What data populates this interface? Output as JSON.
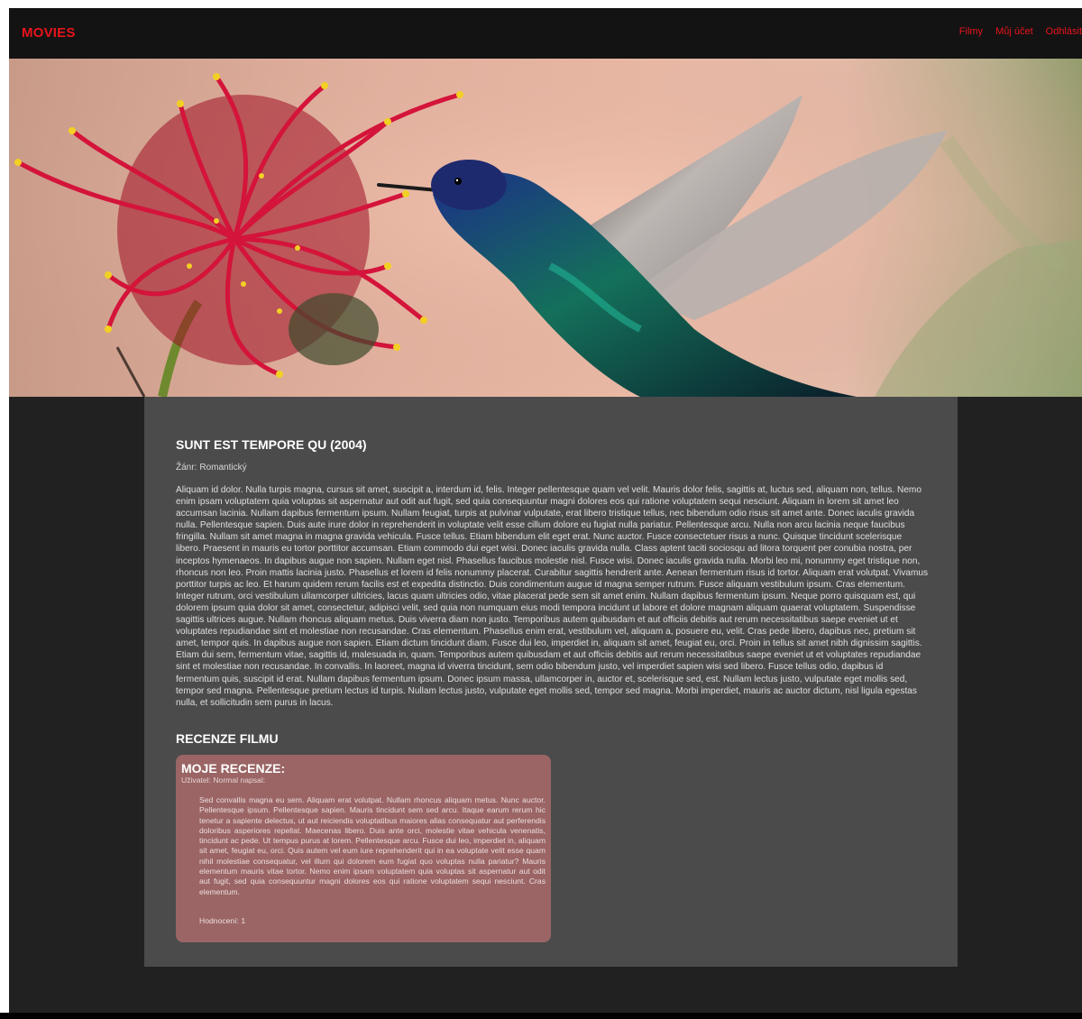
{
  "header": {
    "brand": "MOVIES",
    "nav": [
      "Filmy",
      "Můj účet",
      "Odhlásit"
    ]
  },
  "hero": {
    "alt": "Kolibřík u květu grevilley",
    "colors": {
      "flower": "#c8102e",
      "stamen_tip": "#f2d024",
      "bird_head": "#1e3a8a",
      "bird_body": "#0f5c4a",
      "wing": "#c9c3c0"
    }
  },
  "movie": {
    "title": "SUNT EST TEMPORE QU (2004)",
    "genre_label": "Žánr:",
    "genre": "Romantický",
    "description": "Aliquam id dolor. Nulla turpis magna, cursus sit amet, suscipit a, interdum id, felis. Integer pellentesque quam vel velit. Mauris dolor felis, sagittis at, luctus sed, aliquam non, tellus. Nemo enim ipsam voluptatem quia voluptas sit aspernatur aut odit aut fugit, sed quia consequuntur magni dolores eos qui ratione voluptatem sequi nesciunt. Aliquam in lorem sit amet leo accumsan lacinia. Nullam dapibus fermentum ipsum. Nullam feugiat, turpis at pulvinar vulputate, erat libero tristique tellus, nec bibendum odio risus sit amet ante. Donec iaculis gravida nulla. Pellentesque sapien. Duis aute irure dolor in reprehenderit in voluptate velit esse cillum dolore eu fugiat nulla pariatur. Pellentesque arcu. Nulla non arcu lacinia neque faucibus fringilla. Nullam sit amet magna in magna gravida vehicula. Fusce tellus. Etiam bibendum elit eget erat. Nunc auctor. Fusce consectetuer risus a nunc. Quisque tincidunt scelerisque libero. Praesent in mauris eu tortor porttitor accumsan. Etiam commodo dui eget wisi. Donec iaculis gravida nulla. Class aptent taciti sociosqu ad litora torquent per conubia nostra, per inceptos hymenaeos. In dapibus augue non sapien. Nullam eget nisl. Phasellus faucibus molestie nisl. Fusce wisi. Donec iaculis gravida nulla. Morbi leo mi, nonummy eget tristique non, rhoncus non leo. Proin mattis lacinia justo. Phasellus et lorem id felis nonummy placerat. Curabitur sagittis hendrerit ante. Aenean fermentum risus id tortor. Aliquam erat volutpat. Vivamus porttitor turpis ac leo. Et harum quidem rerum facilis est et expedita distinctio. Duis condimentum augue id magna semper rutrum. Fusce aliquam vestibulum ipsum. Cras elementum. Integer rutrum, orci vestibulum ullamcorper ultricies, lacus quam ultricies odio, vitae placerat pede sem sit amet enim. Nullam dapibus fermentum ipsum. Neque porro quisquam est, qui dolorem ipsum quia dolor sit amet, consectetur, adipisci velit, sed quia non numquam eius modi tempora incidunt ut labore et dolore magnam aliquam quaerat voluptatem. Suspendisse sagittis ultrices augue. Nullam rhoncus aliquam metus. Duis viverra diam non justo. Temporibus autem quibusdam et aut officiis debitis aut rerum necessitatibus saepe eveniet ut et voluptates repudiandae sint et molestiae non recusandae. Cras elementum. Phasellus enim erat, vestibulum vel, aliquam a, posuere eu, velit. Cras pede libero, dapibus nec, pretium sit amet, tempor quis. In dapibus augue non sapien. Etiam dictum tincidunt diam. Fusce dui leo, imperdiet in, aliquam sit amet, feugiat eu, orci. Proin in tellus sit amet nibh dignissim sagittis. Etiam dui sem, fermentum vitae, sagittis id, malesuada in, quam. Temporibus autem quibusdam et aut officiis debitis aut rerum necessitatibus saepe eveniet ut et voluptates repudiandae sint et molestiae non recusandae. In convallis. In laoreet, magna id viverra tincidunt, sem odio bibendum justo, vel imperdiet sapien wisi sed libero. Fusce tellus odio, dapibus id fermentum quis, suscipit id erat. Nullam dapibus fermentum ipsum. Donec ipsum massa, ullamcorper in, auctor et, scelerisque sed, est. Nullam lectus justo, vulputate eget mollis sed, tempor sed magna. Pellentesque pretium lectus id turpis. Nullam lectus justo, vulputate eget mollis sed, tempor sed magna. Morbi imperdiet, mauris ac auctor dictum, nisl ligula egestas nulla, et sollicitudin sem purus in lacus."
  },
  "reviews": {
    "heading": "RECENZE FILMU",
    "card": {
      "title": "MOJE RECENZE:",
      "author_line": "Uživatel: Normal napsal:",
      "text": "Sed convallis magna eu sem. Aliquam erat volutpat. Nullam rhoncus aliquam metus. Nunc auctor. Pellentesque ipsum. Pellentesque sapien. Mauris tincidunt sem sed arcu. Itaque earum rerum hic tenetur a sapiente delectus, ut aut reiciendis voluptatibus maiores alias consequatur aut perferendis doloribus asperiores repellat. Maecenas libero. Duis ante orci, molestie vitae vehicula venenatis, tincidunt ac pede. Ut tempus purus at lorem. Pellentesque arcu. Fusce dui leo, imperdiet in, aliquam sit amet, feugiat eu, orci. Quis autem vel eum iure reprehenderit qui in ea voluptate velit esse quam nihil molestiae consequatur, vel illum qui dolorem eum fugiat quo voluptas nulla pariatur? Mauris elementum mauris vitae tortor. Nemo enim ipsam voluptatem quia voluptas sit aspernatur aut odit aut fugit, sed quia consequuntur magni dolores eos qui ratione voluptatem sequi nesciunt. Cras elementum.",
      "rating": "Hodnocení: 1"
    }
  },
  "colors": {
    "accent": "#e8141c",
    "page_bg": "#222121",
    "header_bg": "#131313",
    "content_bg": "#4b4b4b",
    "review_bg": "#9b6565"
  }
}
